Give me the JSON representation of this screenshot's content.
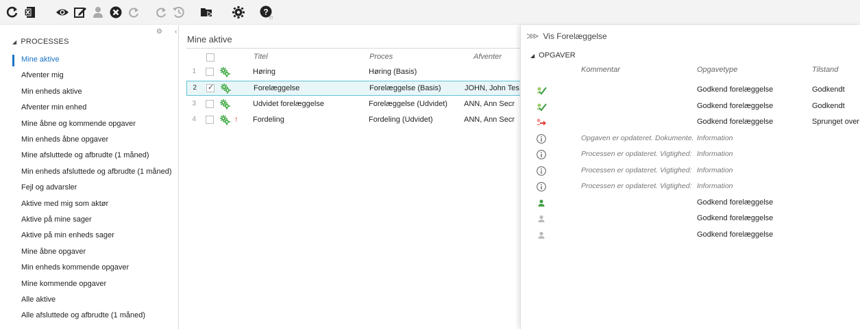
{
  "toolbar": {
    "icons": [
      "refresh-icon",
      "excel-export-icon",
      "view-icon",
      "edit-icon",
      "user-icon",
      "cancel-icon",
      "redo-icon",
      "redo-icon-disabled",
      "history-icon",
      "folder-arrow-icon",
      "settings-gear-icon",
      "help-icon"
    ]
  },
  "sidebar": {
    "section_label": "PROCESSES",
    "items": [
      {
        "label": "Mine aktive",
        "active": true
      },
      {
        "label": "Afventer mig"
      },
      {
        "label": "Min enheds aktive"
      },
      {
        "label": "Afventer min enhed"
      },
      {
        "label": "Mine åbne og kommende opgaver"
      },
      {
        "label": "Min enheds åbne opgaver"
      },
      {
        "label": "Mine afsluttede og afbrudte (1 måned)"
      },
      {
        "label": "Min enheds afsluttede og afbrudte (1 måned)"
      },
      {
        "label": "Fejl og advarsler"
      },
      {
        "label": "Aktive med mig som aktør"
      },
      {
        "label": "Aktive på mine sager"
      },
      {
        "label": "Aktive på min enheds sager"
      },
      {
        "label": "Mine åbne opgaver"
      },
      {
        "label": "Min enheds kommende opgaver"
      },
      {
        "label": "Mine kommende opgaver"
      },
      {
        "label": "Alle aktive"
      },
      {
        "label": "Alle afsluttede og afbrudte (1 måned)"
      }
    ]
  },
  "main": {
    "title": "Mine aktive",
    "columns": {
      "title": "Titel",
      "process": "Proces",
      "awaiting": "Afventer"
    },
    "rows": [
      {
        "num": "1",
        "title": "Høring",
        "process": "Høring (Basis)",
        "awaiting": "",
        "checked": false,
        "selected": false,
        "priority": false
      },
      {
        "num": "2",
        "title": "Forelæggelse",
        "process": "Forelæggelse (Basis)",
        "awaiting": "JOHN, John Tes",
        "checked": true,
        "selected": true,
        "priority": false
      },
      {
        "num": "3",
        "title": "Udvidet forelæggelse",
        "process": "Forelæggelse (Udvidet)",
        "awaiting": "ANN, Ann Secr",
        "checked": false,
        "selected": false,
        "priority": false
      },
      {
        "num": "4",
        "title": "Fordeling",
        "process": "Fordeling (Udvidet)",
        "awaiting": "ANN, Ann Secr",
        "checked": false,
        "selected": false,
        "priority": true,
        "priority_glyph": "↑"
      }
    ]
  },
  "detail": {
    "header": "Vis Forelæggelse",
    "header_glyph": "⋙",
    "section_label": "OPGAVER",
    "columns": {
      "comment": "Kommentar",
      "tasktype": "Opgavetype",
      "state": "Tilstand"
    },
    "tasks": [
      {
        "icon": "approved-check-icon",
        "comment": "",
        "tasktype": "Godkend forelæggelse",
        "state": "Godkendt"
      },
      {
        "icon": "approved-check-icon",
        "comment": "",
        "tasktype": "Godkend forelæggelse",
        "state": "Godkendt"
      },
      {
        "icon": "skipped-arrow-icon",
        "comment": "",
        "tasktype": "Godkend forelæggelse",
        "state": "Sprunget over"
      },
      {
        "icon": "info-icon",
        "comment": "Opgaven er opdateret. Dokumente...",
        "tasktype": "Information",
        "state": "",
        "italic": true
      },
      {
        "icon": "info-icon",
        "comment": "Processen er opdateret. Vigtighed: ...",
        "tasktype": "Information",
        "state": "",
        "italic": true
      },
      {
        "icon": "info-icon",
        "comment": "Processen er opdateret. Vigtighed: ...",
        "tasktype": "Information",
        "state": "",
        "italic": true
      },
      {
        "icon": "info-icon",
        "comment": "Processen er opdateret. Vigtighed: ...",
        "tasktype": "Information",
        "state": "",
        "italic": true
      },
      {
        "icon": "user-active-icon",
        "comment": "",
        "tasktype": "Godkend forelæggelse",
        "state": ""
      },
      {
        "icon": "user-pending-icon",
        "comment": "",
        "tasktype": "Godkend forelæggelse",
        "state": ""
      },
      {
        "icon": "user-pending-icon",
        "comment": "",
        "tasktype": "Godkend forelæggelse",
        "state": ""
      }
    ]
  },
  "colors": {
    "accent": "#1a73c7",
    "selected_bg": "#e9f6f8",
    "selected_border": "#5ec3d3",
    "green": "#4caf50",
    "red": "#e53935"
  }
}
